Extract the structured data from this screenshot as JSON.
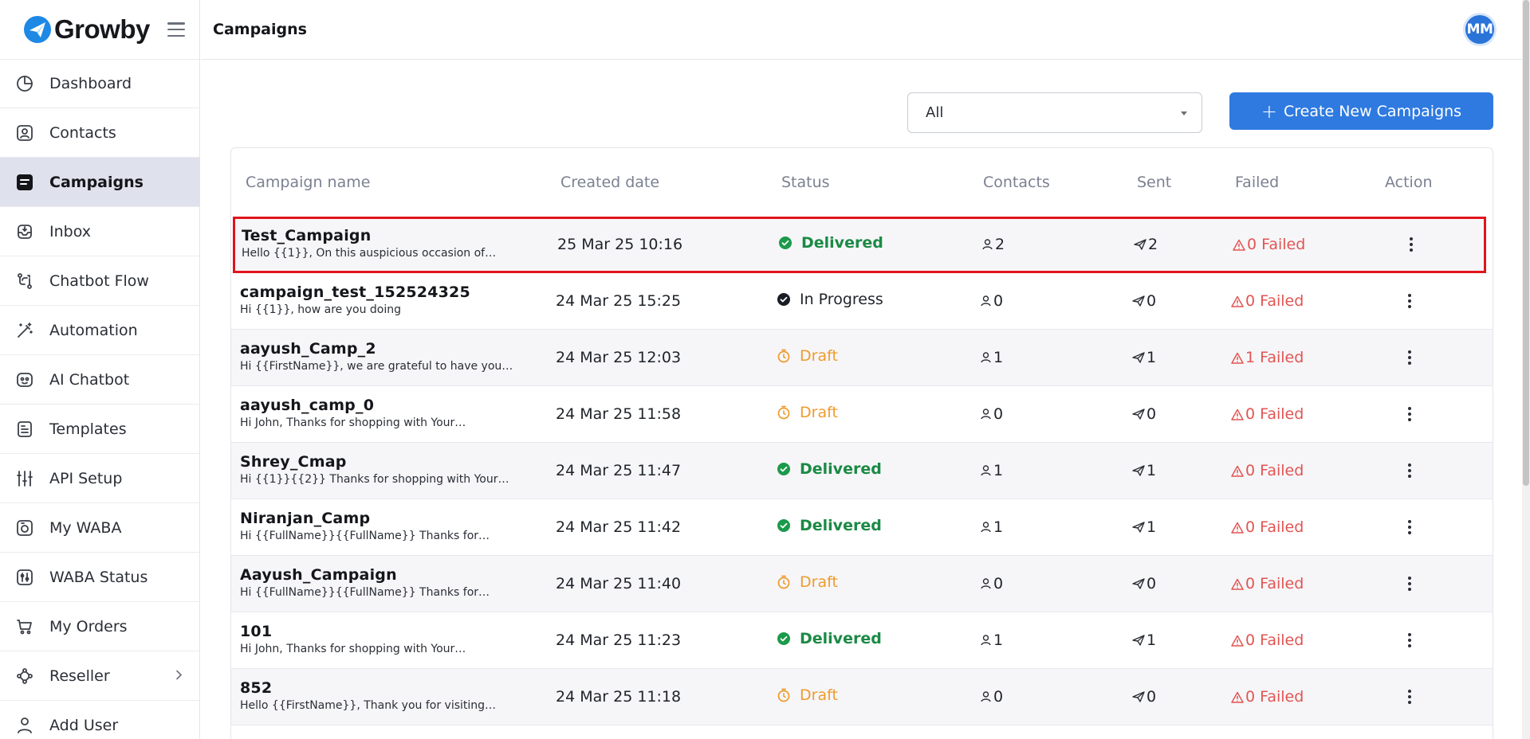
{
  "brand": {
    "name": "Growby"
  },
  "sidebar": {
    "items": [
      {
        "label": "Dashboard",
        "icon": "dashboard-icon"
      },
      {
        "label": "Contacts",
        "icon": "contacts-icon"
      },
      {
        "label": "Campaigns",
        "icon": "campaigns-icon",
        "active": true
      },
      {
        "label": "Inbox",
        "icon": "inbox-icon"
      },
      {
        "label": "Chatbot Flow",
        "icon": "flow-icon"
      },
      {
        "label": "Automation",
        "icon": "wand-icon"
      },
      {
        "label": "AI Chatbot",
        "icon": "bot-icon"
      },
      {
        "label": "Templates",
        "icon": "template-icon"
      },
      {
        "label": "API Setup",
        "icon": "sliders-icon"
      },
      {
        "label": "My WABA",
        "icon": "camera-icon"
      },
      {
        "label": "WABA Status",
        "icon": "status-icon"
      },
      {
        "label": "My Orders",
        "icon": "cart-icon"
      },
      {
        "label": "Reseller",
        "icon": "reseller-icon",
        "has_chevron": true
      },
      {
        "label": "Add User",
        "icon": "add-user-icon"
      }
    ]
  },
  "header": {
    "title": "Campaigns",
    "avatar_initials": "MM"
  },
  "controls": {
    "filter_value": "All",
    "create_label": "Create New Campaigns"
  },
  "table": {
    "columns": {
      "name": "Campaign name",
      "date": "Created date",
      "status": "Status",
      "contacts": "Contacts",
      "sent": "Sent",
      "failed": "Failed",
      "action": "Action"
    },
    "rows": [
      {
        "name": "Test_Campaign",
        "message": "Hello {{1}}, On this auspicious occasion of…",
        "date": "25 Mar 25 10:16",
        "status": "Delivered",
        "contacts": "2",
        "sent": "2",
        "failed": "0 Failed"
      },
      {
        "name": "campaign_test_152524325",
        "message": "Hi {{1}}, how are you doing",
        "date": "24 Mar 25 15:25",
        "status": "In Progress",
        "contacts": "0",
        "sent": "0",
        "failed": "0 Failed"
      },
      {
        "name": "aayush_Camp_2",
        "message": "Hi {{FirstName}}, we are grateful to have you…",
        "date": "24 Mar 25 12:03",
        "status": "Draft",
        "contacts": "1",
        "sent": "1",
        "failed": "1 Failed"
      },
      {
        "name": "aayush_camp_0",
        "message": "Hi John, Thanks for shopping with Your…",
        "date": "24 Mar 25 11:58",
        "status": "Draft",
        "contacts": "0",
        "sent": "0",
        "failed": "0 Failed"
      },
      {
        "name": "Shrey_Cmap",
        "message": "Hi {{1}}{{2}} Thanks for shopping with Your…",
        "date": "24 Mar 25 11:47",
        "status": "Delivered",
        "contacts": "1",
        "sent": "1",
        "failed": "0 Failed"
      },
      {
        "name": "Niranjan_Camp",
        "message": "Hi {{FullName}}{{FullName}} Thanks for…",
        "date": "24 Mar 25 11:42",
        "status": "Delivered",
        "contacts": "1",
        "sent": "1",
        "failed": "0 Failed"
      },
      {
        "name": "Aayush_Campaign",
        "message": "Hi {{FullName}}{{FullName}} Thanks for…",
        "date": "24 Mar 25 11:40",
        "status": "Draft",
        "contacts": "0",
        "sent": "0",
        "failed": "0 Failed"
      },
      {
        "name": "101",
        "message": "Hi John, Thanks for shopping with Your…",
        "date": "24 Mar 25 11:23",
        "status": "Delivered",
        "contacts": "1",
        "sent": "1",
        "failed": "0 Failed"
      },
      {
        "name": "852",
        "message": "Hello {{FirstName}}, Thank you for visiting…",
        "date": "24 Mar 25 11:18",
        "status": "Draft",
        "contacts": "0",
        "sent": "0",
        "failed": "0 Failed"
      }
    ]
  },
  "colors": {
    "accent": "#2f7ae0",
    "delivered": "#1b8a45",
    "draft": "#ef9b2c",
    "failed": "#e25553",
    "highlight": "#e0141d"
  }
}
